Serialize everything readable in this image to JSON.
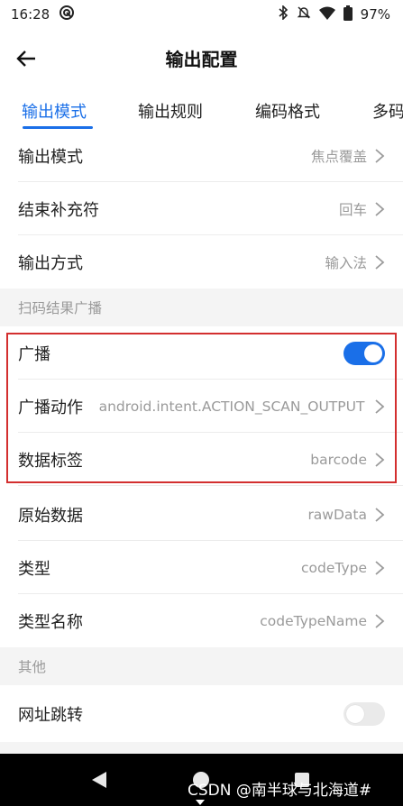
{
  "status_bar": {
    "time": "16:28",
    "battery": "97%"
  },
  "appbar": {
    "title": "输出配置"
  },
  "tabs": [
    "输出模式",
    "输出规则",
    "编码格式",
    "多码"
  ],
  "rows_top": [
    {
      "label": "输出模式",
      "value": "焦点覆盖"
    },
    {
      "label": "结束补充符",
      "value": "回车"
    },
    {
      "label": "输出方式",
      "value": "输入法"
    }
  ],
  "section_broadcast": "扫码结果广播",
  "broadcast": {
    "label": "广播",
    "enabled": true
  },
  "broadcast_action": {
    "label": "广播动作",
    "value": "android.intent.ACTION_SCAN_OUTPUT"
  },
  "rows_broadcast": [
    {
      "label": "数据标签",
      "value": "barcode"
    },
    {
      "label": "原始数据",
      "value": "rawData"
    },
    {
      "label": "类型",
      "value": "codeType"
    },
    {
      "label": "类型名称",
      "value": "codeTypeName"
    }
  ],
  "section_other": "其他",
  "url_jump": {
    "label": "网址跳转",
    "enabled": false
  },
  "watermark": "CSDN @南半球与北海道#",
  "colors": {
    "accent": "#1a6fe8",
    "highlight": "#d32f2f"
  }
}
